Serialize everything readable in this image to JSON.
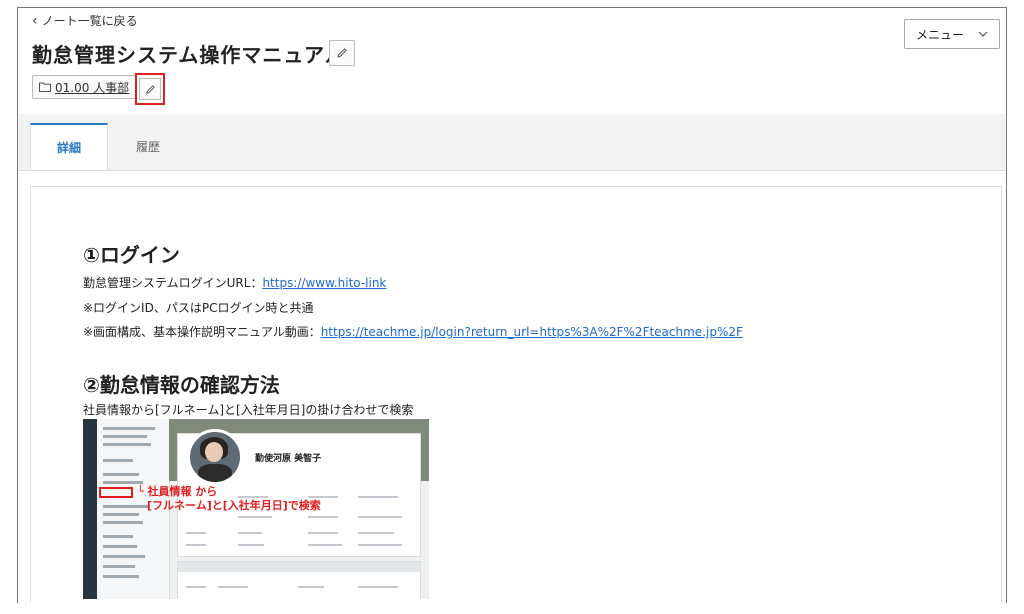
{
  "nav": {
    "back_label": "ノート一覧に戻る"
  },
  "header": {
    "title": "勤怠管理システム操作マニュアル",
    "folder_label": "01.00 人事部",
    "menu_label": "メニュー"
  },
  "tabs": [
    {
      "label": "詳細",
      "active": true
    },
    {
      "label": "履歴",
      "active": false
    }
  ],
  "content": {
    "section1_heading": "①ログイン",
    "login_url_label": "勤怠管理システムログインURL：",
    "login_url": "https://www.hito-link",
    "note_line": "※ログインID、パスはPCログイン時と共通",
    "manual_label": "※画面構成、基本操作説明マニュアル動画：",
    "manual_url": "https://teachme.jp/login?return_url=https%3A%2F%2Fteachme.jp%2F",
    "section2_heading": "②勤怠情報の確認方法",
    "section2_text": "社員情報から[フルネーム]と[入社年月日]の掛け合わせで検索",
    "screenshot": {
      "employee_name": "勤使河原 美智子",
      "annotation_line1": "└ 社員情報 から",
      "annotation_line2": "[フルネーム]と[入社年月日]で検索"
    }
  },
  "colors": {
    "accent": "#2a78c8",
    "highlight": "#e02020",
    "link": "#1e6ad0"
  }
}
